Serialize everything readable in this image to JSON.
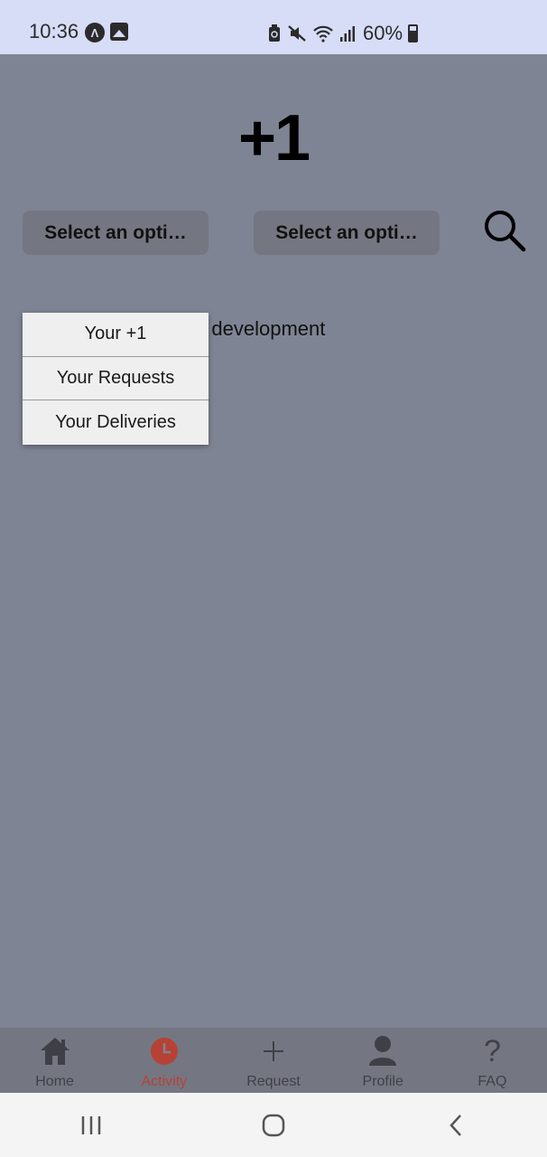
{
  "status_bar": {
    "time": "10:36",
    "battery": "60%"
  },
  "header": {
    "title": "+1"
  },
  "filters": {
    "select_one": "Select an opti…",
    "select_two": "Select an opti…"
  },
  "main": {
    "message": "Still currently under development"
  },
  "dropdown": {
    "items": [
      {
        "label": "Your +1"
      },
      {
        "label": "Your Requests"
      },
      {
        "label": "Your Deliveries"
      }
    ]
  },
  "tabs": [
    {
      "label": "Home",
      "icon": "home-icon"
    },
    {
      "label": "Activity",
      "icon": "clock-icon",
      "active": true
    },
    {
      "label": "Request",
      "icon": "plus-icon"
    },
    {
      "label": "Profile",
      "icon": "person-icon"
    },
    {
      "label": "FAQ",
      "icon": "question-icon"
    }
  ],
  "colors": {
    "overlay_background": "#7f8494",
    "active_tab": "#b64235",
    "status_bar": "#d7dcf7"
  }
}
